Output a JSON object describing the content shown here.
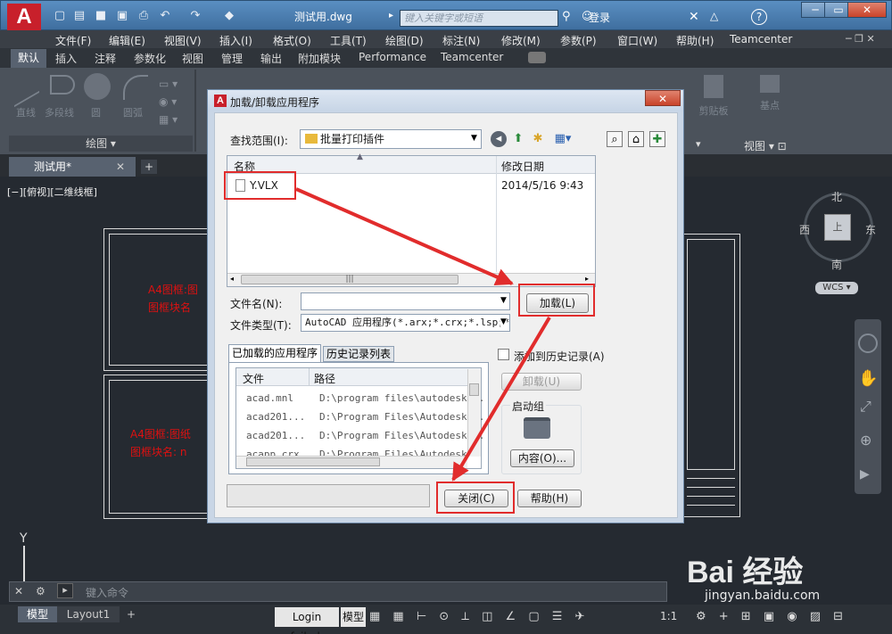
{
  "titlebar": {
    "app_logo": "A",
    "doc_title": "测试用.dwg",
    "search_placeholder": "键入关键字或短语",
    "login": "登录",
    "help": "?"
  },
  "menu": [
    "文件(F)",
    "编辑(E)",
    "视图(V)",
    "插入(I)",
    "格式(O)",
    "工具(T)",
    "绘图(D)",
    "标注(N)",
    "修改(M)",
    "参数(P)",
    "窗口(W)",
    "帮助(H)",
    "Teamcenter"
  ],
  "ribbon_tabs": [
    "默认",
    "插入",
    "注释",
    "参数化",
    "视图",
    "管理",
    "输出",
    "附加模块",
    "Performance",
    "Teamcenter"
  ],
  "ribbon": {
    "tools": [
      "直线",
      "多段线",
      "圆",
      "圆弧"
    ],
    "panel_draw": "绘图",
    "right_tools": [
      "剪贴板",
      "基点",
      "视图"
    ]
  },
  "doc_tab": {
    "label": "测试用*",
    "close": "✕",
    "add": "+"
  },
  "view_label": "[−][俯视][二维线框]",
  "drawing_text": {
    "frame1_line1": "A4图框:图",
    "frame1_line2": "图框块名",
    "frame2_line1": "A4图框:图纸",
    "frame2_line2": "图框块名: n"
  },
  "compass": {
    "north": "北",
    "south": "南",
    "east": "东",
    "west": "西",
    "wcs": "WCS"
  },
  "axis_y": "Y",
  "cmd_placeholder": "键入命令",
  "status": {
    "tab_model": "模型",
    "tab_layout": "Layout1",
    "login_failed": "Login failed.",
    "mode_model": "模型",
    "scale": "1:1"
  },
  "watermark": {
    "brand": "Bai 经验",
    "url": "jingyan.baidu.com"
  },
  "dialog": {
    "title": "加载/卸载应用程序",
    "close": "✕",
    "look_in_label": "查找范围(I):",
    "look_in_value": "批量打印插件",
    "columns": [
      "名称",
      "修改日期"
    ],
    "files": [
      {
        "name": "Y.VLX",
        "date": "2014/5/16 9:43"
      }
    ],
    "filename_label": "文件名(N):",
    "filename_value": "",
    "filetype_label": "文件类型(T):",
    "filetype_value": "AutoCAD 应用程序(*.arx;*.crx;*.lsp;*",
    "load_button": "加载(L)",
    "tab_loaded": "已加载的应用程序",
    "tab_history": "历史记录列表",
    "add_history": "添加到历史记录(A)",
    "app_columns": [
      "文件",
      "路径"
    ],
    "apps": [
      {
        "file": "acad.mnl",
        "path": "D:\\program files\\autodesk..."
      },
      {
        "file": "acad201...",
        "path": "D:\\Program Files\\Autodesk..."
      },
      {
        "file": "acad201...",
        "path": "D:\\Program Files\\Autodesk..."
      },
      {
        "file": "acapp.crx",
        "path": "D:\\Program Files\\Autodesk..."
      }
    ],
    "unload_button": "卸载(U)",
    "startup_group": "启动组",
    "contents_button": "内容(O)...",
    "close_button": "关闭(C)",
    "help_button": "帮助(H)"
  },
  "colors": {
    "highlight": "#e12c2c",
    "annotation_text": "#dd1111",
    "background": "#252a31"
  }
}
